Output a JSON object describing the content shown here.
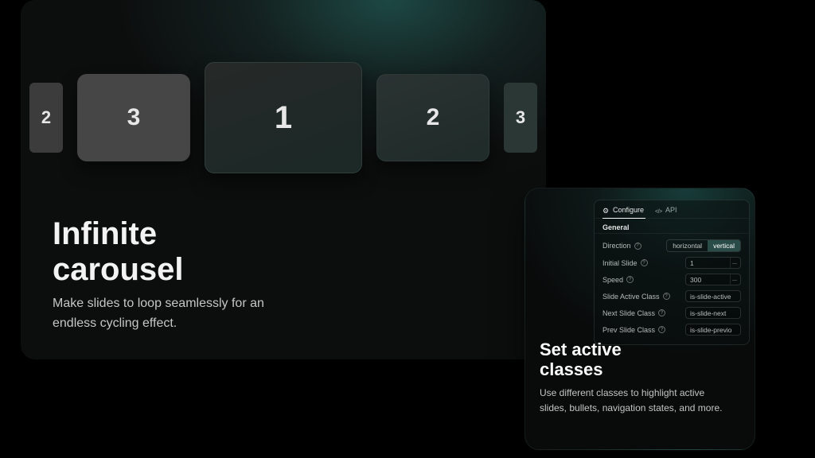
{
  "carousel_card": {
    "slides": [
      "2",
      "3",
      "1",
      "2",
      "3"
    ],
    "title_line1": "Infinite",
    "title_line2": "carousel",
    "subtitle": "Make slides to loop seamlessly for an endless cycling effect."
  },
  "classes_card": {
    "tabs": {
      "configure": "Configure",
      "api": "API"
    },
    "section": "General",
    "rows": {
      "direction": {
        "label": "Direction",
        "opt1": "horizontal",
        "opt2": "vertical"
      },
      "initial": {
        "label": "Initial Slide",
        "value": "1"
      },
      "speed": {
        "label": "Speed",
        "value": "300"
      },
      "active": {
        "label": "Slide Active Class",
        "value": "is-slide-active"
      },
      "next": {
        "label": "Next Slide Class",
        "value": "is-slide-next"
      },
      "prev": {
        "label": "Prev Slide Class",
        "value": "is-slide-previo"
      }
    },
    "title_line1": "Set active",
    "title_line2": "classes",
    "subtitle": "Use different classes to highlight active slides, bullets, navigation states, and more."
  }
}
